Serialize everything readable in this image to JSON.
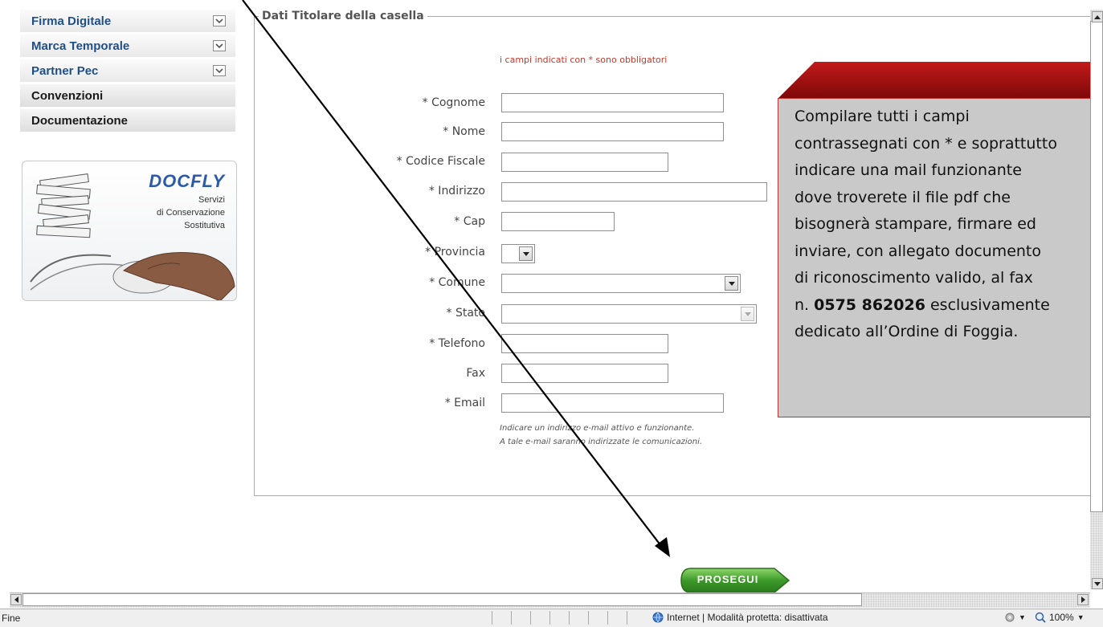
{
  "sidebar": {
    "items": [
      {
        "label": "Firma Digitale",
        "expandable": true
      },
      {
        "label": "Marca Temporale",
        "expandable": true
      },
      {
        "label": "Partner Pec",
        "expandable": true
      },
      {
        "label": "Convenzioni",
        "expandable": false
      },
      {
        "label": "Documentazione",
        "expandable": false
      }
    ],
    "banner": {
      "brand": "DOCFLY",
      "line1": "Servizi",
      "line2": "di Conservazione",
      "line3": "Sostitutiva"
    }
  },
  "form": {
    "legend": "Dati Titolare della casella",
    "required_note": "i campi indicati con * sono obbligatori",
    "fields": {
      "cognome": {
        "label": "* Cognome",
        "value": ""
      },
      "nome": {
        "label": "* Nome",
        "value": ""
      },
      "codice_fiscale": {
        "label": "* Codice Fiscale",
        "value": ""
      },
      "indirizzo": {
        "label": "* Indirizzo",
        "value": ""
      },
      "cap": {
        "label": "* Cap",
        "value": ""
      },
      "provincia": {
        "label": "* Provincia",
        "value": ""
      },
      "comune": {
        "label": "* Comune",
        "value": ""
      },
      "stato": {
        "label": "* Stato",
        "value": ""
      },
      "telefono": {
        "label": "* Telefono",
        "value": ""
      },
      "fax": {
        "label": "Fax",
        "value": ""
      },
      "email": {
        "label": "* Email",
        "value": ""
      }
    },
    "email_hint_1": "Indicare un indirizzo e-mail attivo e funzionante.",
    "email_hint_2": "A tale e-mail saranno indirizzate le comunicazioni.",
    "submit_label": "PROSEGUI"
  },
  "callout": {
    "line1": "Compilare tutti i campi",
    "line2": "contrassegnati con * e soprattutto",
    "line3": "indicare una mail funzionante",
    "line4": "dove troverete il file pdf che",
    "line5": "bisognerà  stampare, firmare ed",
    "line6": "inviare, con allegato documento",
    "line7": "di riconoscimento valido,  al fax",
    "line8_prefix": "n. ",
    "line8_bold": "0575 862026",
    "line8_suffix": " esclusivamente",
    "line9": "dedicato all’Ordine di Foggia."
  },
  "statusbar": {
    "status": "Fine",
    "zone": "Internet | Modalità protetta: disattivata",
    "zoom": "100%"
  },
  "colors": {
    "link_blue": "#1f4f86",
    "required_red": "#c0392b",
    "callout_bg": "#c9c9c9",
    "callout_header": "#9b0c0c",
    "button_green": "#3d9a2a"
  }
}
